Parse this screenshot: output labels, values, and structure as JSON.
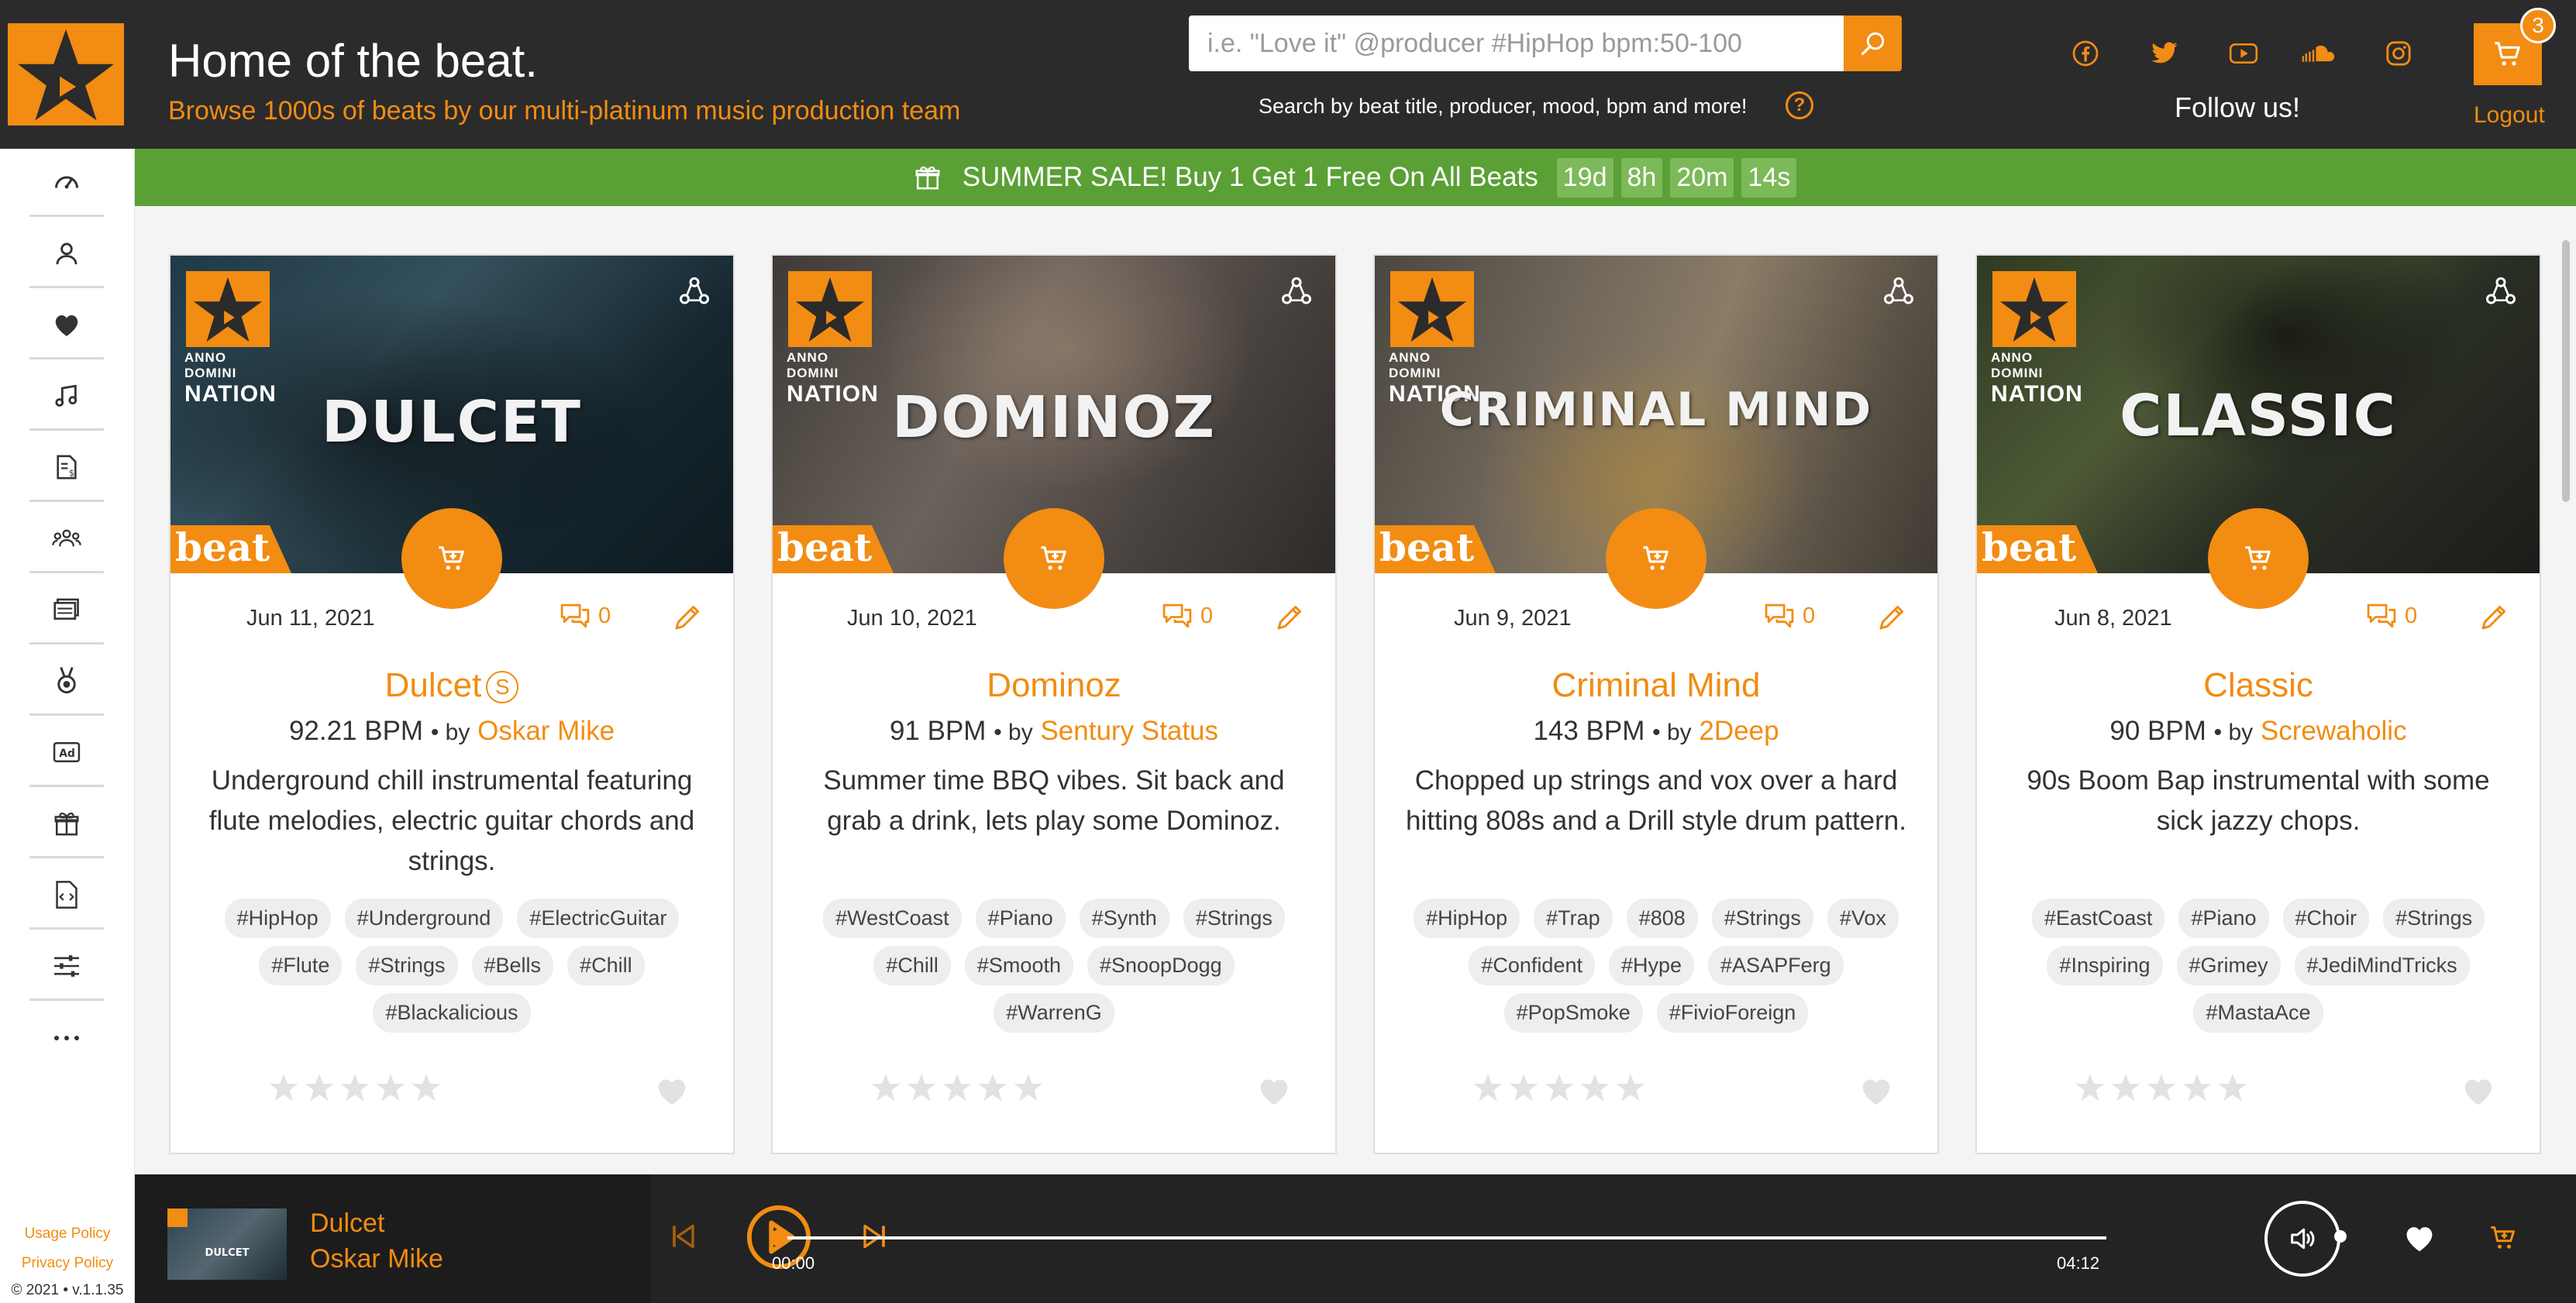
{
  "header": {
    "title": "Home of the beat.",
    "subtitle": "Browse 1000s of beats by our multi-platinum music production team",
    "search_placeholder": "i.e. \"Love it\" @producer #HipHop bpm:50-100",
    "search_hint": "Search by beat title, producer, mood, bpm and more!",
    "hint_icon": "?",
    "social": [
      "facebook-icon",
      "twitter-icon",
      "youtube-icon",
      "soundcloud-icon",
      "instagram-icon"
    ],
    "follow_label": "Follow us!",
    "cart_count": "3",
    "logout_label": "Logout"
  },
  "promo": {
    "text": "SUMMER SALE! Buy 1 Get 1 Free On All Beats",
    "countdown": [
      "19d",
      "8h",
      "20m",
      "14s"
    ]
  },
  "sidebar": {
    "items": [
      "dashboard-icon",
      "user-icon",
      "heart-icon",
      "music-icon",
      "invoice-icon",
      "group-icon",
      "media-icon",
      "award-icon",
      "ad-icon",
      "gift-icon",
      "code-file-icon",
      "sliders-icon",
      "more-icon"
    ],
    "usage_policy": "Usage Policy",
    "privacy_policy": "Privacy Policy",
    "version": "© 2021 • v.1.1.35"
  },
  "cards": [
    {
      "cover_title": "DULCET",
      "date": "Jun 11, 2021",
      "comments": "0",
      "title": "Dulcet",
      "badge": "S",
      "bpm": "92.21 BPM",
      "by": "• by",
      "producer": "Oskar Mike",
      "description": "Underground chill instrumental featuring flute melodies, electric guitar chords and strings.",
      "tags": [
        "#HipHop",
        "#Underground",
        "#ElectricGuitar",
        "#Flute",
        "#Strings",
        "#Bells",
        "#Chill",
        "#Blackalicious"
      ]
    },
    {
      "cover_title": "DOMINOZ",
      "date": "Jun 10, 2021",
      "comments": "0",
      "title": "Dominoz",
      "bpm": "91 BPM",
      "by": "• by",
      "producer": "Sentury Status",
      "description": "Summer time BBQ vibes. Sit back and grab a drink, lets play some Dominoz.",
      "tags": [
        "#WestCoast",
        "#Piano",
        "#Synth",
        "#Strings",
        "#Chill",
        "#Smooth",
        "#SnoopDogg",
        "#WarrenG"
      ]
    },
    {
      "cover_title": "CRIMINAL MIND",
      "date": "Jun 9, 2021",
      "comments": "0",
      "title": "Criminal Mind",
      "bpm": "143 BPM",
      "by": "• by",
      "producer": "2Deep",
      "description": "Chopped up strings and vox over a hard hitting 808s and a Drill style drum pattern.",
      "tags": [
        "#HipHop",
        "#Trap",
        "#808",
        "#Strings",
        "#Vox",
        "#Confident",
        "#Hype",
        "#ASAPFerg",
        "#PopSmoke",
        "#FivioForeign"
      ]
    },
    {
      "cover_title": "CLASSIC",
      "date": "Jun 8, 2021",
      "comments": "0",
      "title": "Classic",
      "bpm": "90 BPM",
      "by": "• by",
      "producer": "Screwaholic",
      "description": "90s Boom Bap instrumental with some sick jazzy chops.",
      "tags": [
        "#EastCoast",
        "#Piano",
        "#Choir",
        "#Strings",
        "#Inspiring",
        "#Grimey",
        "#JediMindTricks",
        "#MastaAce"
      ]
    }
  ],
  "cover_brand": [
    "ANNO",
    "DOMINI",
    "NATION"
  ],
  "cover_beat_label": "beat",
  "player": {
    "title": "Dulcet",
    "artist": "Oskar Mike",
    "thumb_title": "DULCET",
    "current_time": "00:00",
    "duration": "04:12",
    "progress": 0
  },
  "colors": {
    "accent": "#f28c12",
    "header_bg": "#2b2b2b",
    "promo_bg": "#5aa035",
    "player_bg": "#232323"
  }
}
